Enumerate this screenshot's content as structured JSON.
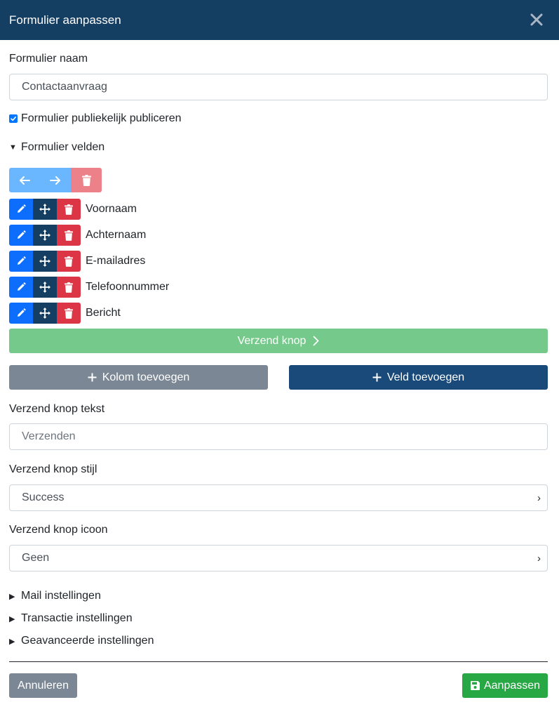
{
  "modal": {
    "title": "Formulier aanpassen"
  },
  "form_name": {
    "label": "Formulier naam",
    "value": "Contactaanvraag"
  },
  "publish": {
    "label": "Formulier publiekelijk publiceren",
    "checked": true
  },
  "fields_section": {
    "label": "Formulier velden"
  },
  "fields": [
    {
      "label": "Voornaam"
    },
    {
      "label": "Achternaam"
    },
    {
      "label": "E-mailadres"
    },
    {
      "label": "Telefoonnummer"
    },
    {
      "label": "Bericht"
    }
  ],
  "submit_preview": {
    "label": "Verzend knop"
  },
  "actions": {
    "add_column": "Kolom toevoegen",
    "add_field": "Veld toevoegen"
  },
  "submit_text": {
    "label": "Verzend knop tekst",
    "placeholder": "Verzenden"
  },
  "submit_style": {
    "label": "Verzend knop stijl",
    "value": "Success"
  },
  "submit_icon": {
    "label": "Verzend knop icoon",
    "value": "Geen"
  },
  "collapsed_sections": [
    {
      "label": "Mail instellingen"
    },
    {
      "label": "Transactie instellingen"
    },
    {
      "label": "Geavanceerde instellingen"
    }
  ],
  "footer": {
    "cancel": "Annuleren",
    "save": "Aanpassen"
  },
  "colors": {
    "header": "#153e63",
    "primary": "#0d6efd",
    "danger": "#dc3545",
    "success": "#28a745",
    "secondary": "#7b8794"
  },
  "icons": [
    "close-icon",
    "arrow-left-icon",
    "arrow-right-icon",
    "trash-icon",
    "pencil-icon",
    "move-icon",
    "chevron-right-icon",
    "plus-icon",
    "save-icon"
  ]
}
